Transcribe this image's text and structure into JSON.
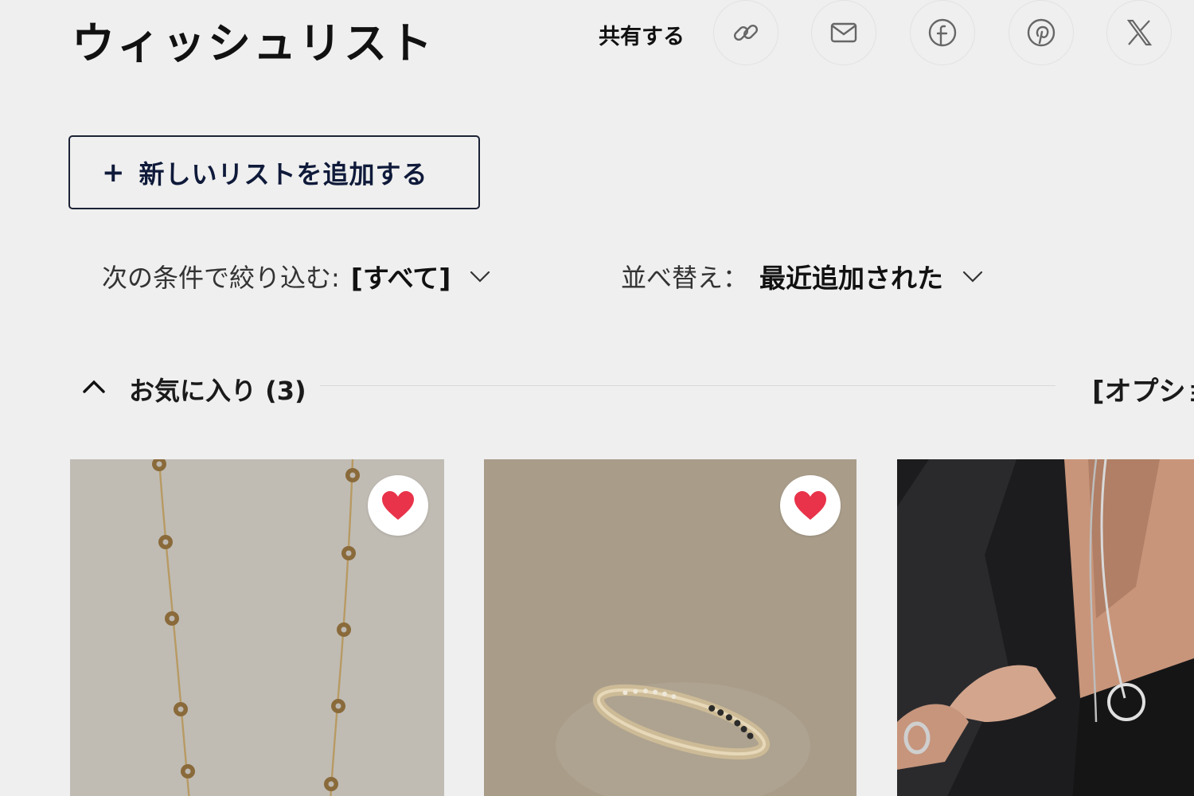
{
  "header": {
    "title": "ウィッシュリスト",
    "share_label": "共有する",
    "share_buttons": [
      "link-icon",
      "mail-icon",
      "facebook-icon",
      "pinterest-icon",
      "x-icon"
    ]
  },
  "actions": {
    "add_list_plus": "+",
    "add_list_label": "新しいリストを追加する"
  },
  "filter": {
    "prefix": "次の条件で絞り込む:",
    "value": "[すべて]"
  },
  "sort": {
    "prefix": "並べ替え：",
    "value": "最近追加された"
  },
  "section": {
    "title": "お気に入り (3)",
    "options_label": "[オプション]"
  },
  "colors": {
    "background": "#efefef",
    "primary_text": "#111111",
    "button_border": "#1b2235",
    "heart": "#e8334a"
  },
  "products": [
    {
      "name": "flower-chain-necklace",
      "favorited": true
    },
    {
      "name": "black-diamond-eternity-ring",
      "favorited": true
    },
    {
      "name": "silver-layered-necklace-model",
      "favorited": false
    }
  ]
}
